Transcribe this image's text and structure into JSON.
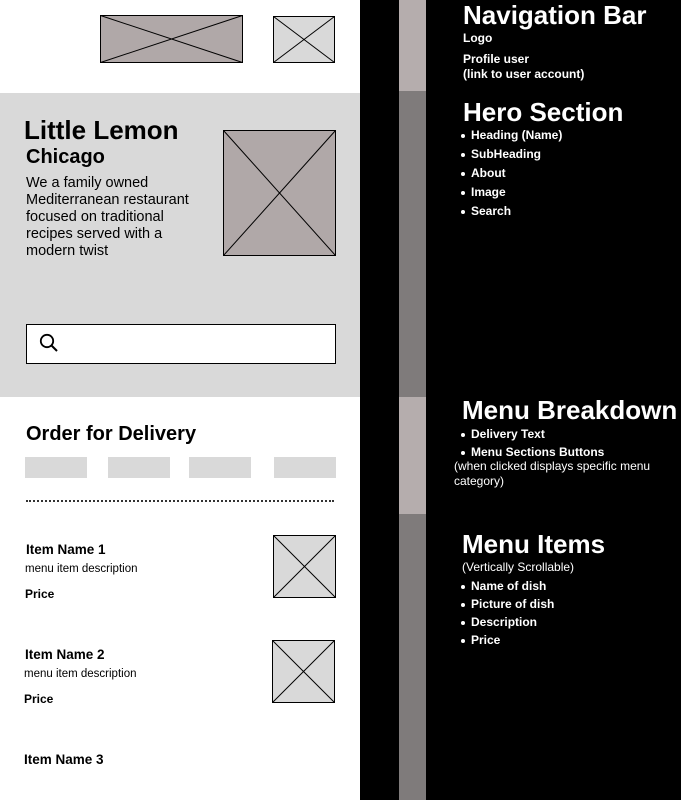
{
  "wireframe": {
    "hero": {
      "title": "Little Lemon",
      "subtitle": "Chicago",
      "about": "We a family owned Mediterranean restaurant focused on traditional recipes served with a modern twist"
    },
    "order_heading": "Order for Delivery",
    "menu_items": [
      {
        "name": "Item Name 1",
        "description": "menu item description",
        "price": "Price"
      },
      {
        "name": "Item Name 2",
        "description": "menu item description",
        "price": "Price"
      },
      {
        "name": "Item Name 3"
      }
    ]
  },
  "annotations": {
    "nav": {
      "title": "Navigation Bar",
      "line1": "Logo",
      "line2": "Profile user",
      "line3": "(link to user account)"
    },
    "hero": {
      "title": "Hero Section",
      "items": [
        "Heading (Name)",
        "SubHeading",
        "About",
        "Image",
        "Search"
      ]
    },
    "breakdown": {
      "title": "Menu Breakdown",
      "items": [
        "Delivery Text",
        "Menu Sections Buttons"
      ],
      "note": "(when clicked displays specific menu category)"
    },
    "menu_items": {
      "title": "Menu Items",
      "note": "(Vertically Scrollable)",
      "items": [
        "Name of dish",
        "Picture of dish",
        "Description",
        "Price"
      ]
    }
  },
  "colors": {
    "placeholder_dark": "#b0a8a8",
    "placeholder_light": "#d9d9d9",
    "hero_bg": "#d9d9d9",
    "strip_light": "#b5adad",
    "strip_dark": "#7f7b7b"
  }
}
